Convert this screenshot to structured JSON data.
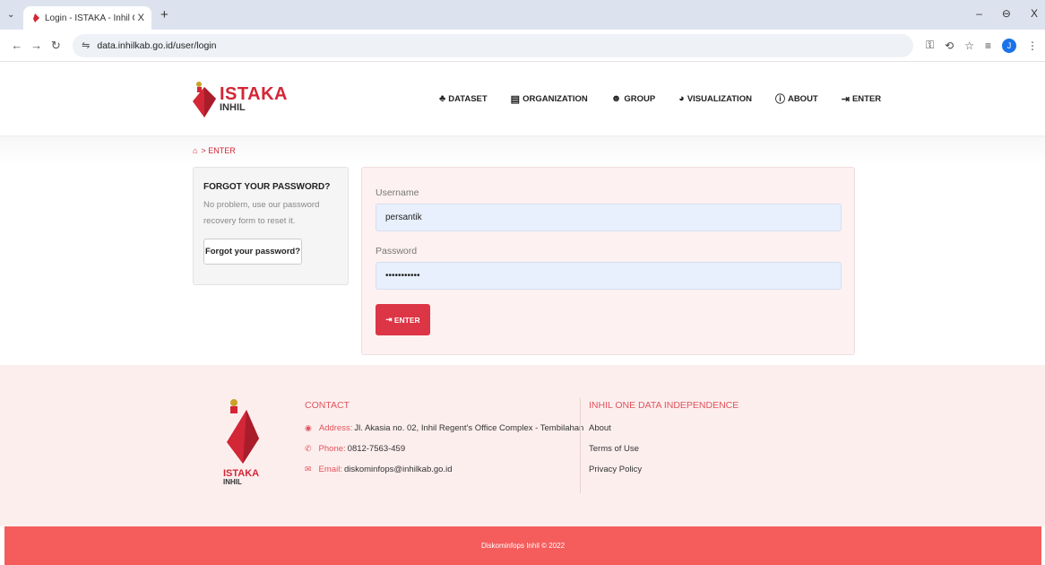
{
  "browser": {
    "tab_title": "Login - ISTAKA - Inhil One Data",
    "tab_close": "X",
    "new_tab": "+",
    "url": "data.inhilkab.go.id/user/login",
    "window_controls": [
      "–",
      "⊖",
      "X"
    ],
    "profile_initial": "J"
  },
  "site": {
    "logo_big": "ISTAKA",
    "logo_small": "INHIL",
    "nav": [
      {
        "label": "DATASET",
        "icon": "sitemap-icon"
      },
      {
        "label": "ORGANIZATION",
        "icon": "building-icon"
      },
      {
        "label": "GROUP",
        "icon": "users-icon"
      },
      {
        "label": "VISUALIZATION",
        "icon": "pie-chart-icon"
      },
      {
        "label": "ABOUT",
        "icon": "info-icon"
      },
      {
        "label": "ENTER",
        "icon": "sign-in-icon"
      }
    ]
  },
  "breadcrumb": {
    "current": "ENTER"
  },
  "sidebar": {
    "title": "FORGOT YOUR PASSWORD?",
    "text": "No problem, use our password recovery form to reset it.",
    "button": "Forgot your password?"
  },
  "login": {
    "username_label": "Username",
    "username_value": "persantik",
    "password_label": "Password",
    "password_value": "•••••••••••",
    "submit": "ENTER"
  },
  "footer": {
    "contact_title": "CONTACT",
    "address_label": "Address:",
    "address": "Jl. Akasia no. 02, Inhil Regent's Office Complex - Tembilahan",
    "phone_label": "Phone:",
    "phone": "0812-7563-459",
    "email_label": "Email:",
    "email": "diskominfops@inhilkab.go.id",
    "indep_title": "INHIL ONE DATA INDEPENDENCE",
    "links": [
      "About",
      "Terms of Use",
      "Privacy Policy"
    ],
    "copyright": "Diskominfops Inhil © 2022"
  },
  "colors": {
    "brand_red": "#d32636",
    "button_red": "#dc3545",
    "footer_bar": "#f55c5c"
  }
}
